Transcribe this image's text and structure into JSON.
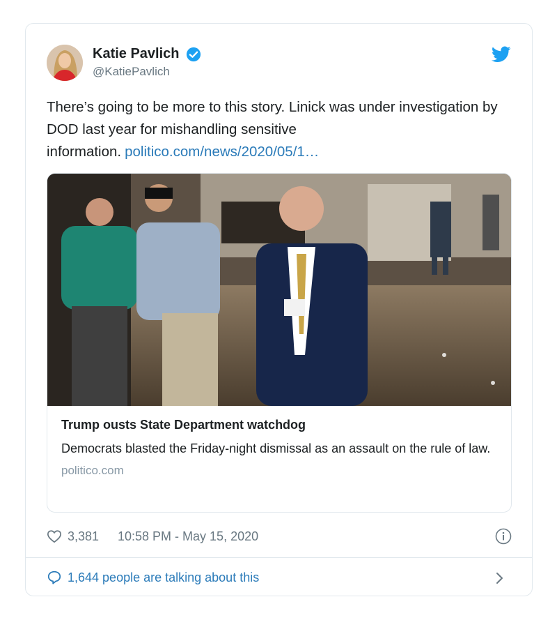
{
  "author": {
    "display_name": "Katie Pavlich",
    "handle": "@KatiePavlich",
    "verified": true
  },
  "tweet": {
    "text": "There’s going to be more to this story. Linick was under investigation by DOD last year for mishandling sensitive information.",
    "link_text": "politico.com/news/2020/05/1…"
  },
  "card": {
    "image_icon": "news-photo",
    "title": "Trump ousts State Department watchdog",
    "description": "Democrats blasted the Friday-night dismissal as an assault on the rule of law.",
    "domain": "politico.com"
  },
  "meta": {
    "likes": "3,381",
    "timestamp": "10:58 PM - May 15, 2020"
  },
  "footer": {
    "talking": "1,644 people are talking about this"
  },
  "colors": {
    "twitter_blue": "#1da1f2",
    "link": "#2b7bb9",
    "muted": "#697882",
    "border": "#e1e8ed"
  }
}
